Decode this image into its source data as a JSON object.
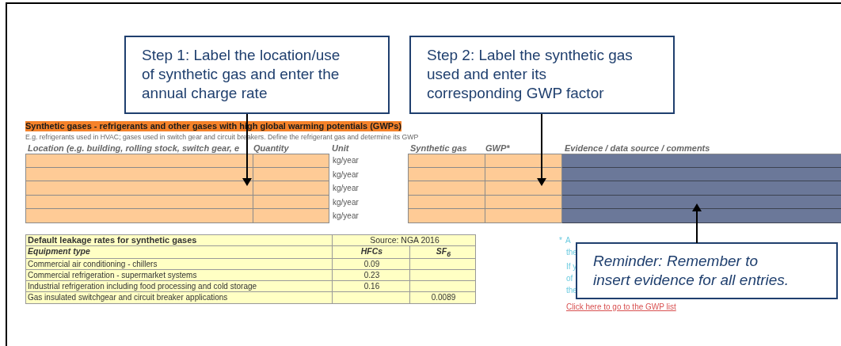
{
  "callouts": [
    {
      "kind": "step",
      "text": "Step 1: Label the location/use\nof synthetic gas and enter the\nannual charge rate"
    },
    {
      "kind": "step",
      "text": "Step 2: Label the synthetic gas\nused and enter its\ncorresponding GWP factor"
    }
  ],
  "section": {
    "title": "Synthetic gases - refrigerants and other gases with high global warming potentials (GWPs)",
    "subtitle": "E.g. refrigerants used in HVAC; gases used in switch gear and circuit breakers. Define the refrigerant gas and determine its GWP"
  },
  "entry_table": {
    "columns": [
      "Location (e.g. building, rolling stock, switch gear, e",
      "Quantity",
      "Unit",
      "Synthetic gas",
      "GWP*",
      "Evidence / data source / comments"
    ],
    "rows": [
      {
        "unit": "kg/year"
      },
      {
        "unit": "kg/year"
      },
      {
        "unit": "kg/year"
      },
      {
        "unit": "kg/year"
      },
      {
        "unit": "kg/year"
      }
    ]
  },
  "leakage_table": {
    "title": "Default leakage rates for synthetic gases",
    "source": "Source: NGA 2016",
    "columns": [
      "Equipment type",
      "HFCs",
      "SF$_{6}$"
    ],
    "rows": [
      [
        "Commercial air conditioning - chillers",
        "0.09",
        ""
      ],
      [
        "Commercial refrigeration - supermarket systems",
        "0.23",
        ""
      ],
      [
        "Industrial refrigeration including food processing and cold storage",
        "0.16",
        ""
      ],
      [
        "Gas insulated switchgear and circuit breaker applications",
        "",
        "0.0089"
      ]
    ]
  },
  "notes": {
    "marker": "*",
    "lines": [
      "A",
      "the",
      "If y",
      "of",
      "the"
    ],
    "link": "Click here to go to the GWP list"
  },
  "reminder": {
    "text": "Reminder: Remember to\ninsert evidence for all entries."
  }
}
